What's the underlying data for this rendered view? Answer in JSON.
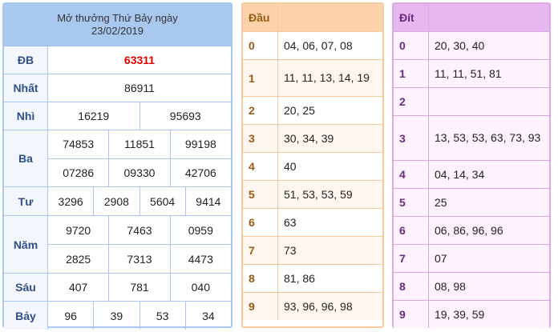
{
  "results": {
    "title_line1": "Mở thưởng Thứ Bảy ngày",
    "title_line2": "23/02/2019",
    "rows": [
      {
        "label": "ĐB",
        "lines": [
          [
            "63311"
          ]
        ]
      },
      {
        "label": "Nhất",
        "lines": [
          [
            "86911"
          ]
        ]
      },
      {
        "label": "Nhì",
        "lines": [
          [
            "16219",
            "95693"
          ]
        ]
      },
      {
        "label": "Ba",
        "lines": [
          [
            "74853",
            "11851",
            "99198"
          ],
          [
            "07286",
            "09330",
            "42706"
          ]
        ]
      },
      {
        "label": "Tư",
        "lines": [
          [
            "3296",
            "2908",
            "5604",
            "9414"
          ]
        ]
      },
      {
        "label": "Năm",
        "lines": [
          [
            "9720",
            "7463",
            "0959"
          ],
          [
            "2825",
            "7313",
            "4473"
          ]
        ]
      },
      {
        "label": "Sáu",
        "lines": [
          [
            "407",
            "781",
            "040"
          ]
        ]
      },
      {
        "label": "Bảy",
        "lines": [
          [
            "96",
            "39",
            "53",
            "34"
          ]
        ]
      }
    ]
  },
  "dau": {
    "header": "Đầu",
    "rows": [
      {
        "key": "0",
        "value": "04, 06, 07, 08"
      },
      {
        "key": "1",
        "value": "11, 11, 13, 14, 19"
      },
      {
        "key": "2",
        "value": "20, 25"
      },
      {
        "key": "3",
        "value": "30, 34, 39"
      },
      {
        "key": "4",
        "value": "40"
      },
      {
        "key": "5",
        "value": "51, 53, 53, 59"
      },
      {
        "key": "6",
        "value": "63"
      },
      {
        "key": "7",
        "value": "73"
      },
      {
        "key": "8",
        "value": "81, 86"
      },
      {
        "key": "9",
        "value": "93, 96, 96, 98"
      }
    ]
  },
  "dit": {
    "header": "Đít",
    "rows": [
      {
        "key": "0",
        "value": "20, 30, 40"
      },
      {
        "key": "1",
        "value": "11, 11, 51, 81"
      },
      {
        "key": "2",
        "value": ""
      },
      {
        "key": "3",
        "value": "13, 53, 53, 63, 73, 93"
      },
      {
        "key": "4",
        "value": "04, 14, 34"
      },
      {
        "key": "5",
        "value": "25"
      },
      {
        "key": "6",
        "value": "06, 86, 96, 96"
      },
      {
        "key": "7",
        "value": "07"
      },
      {
        "key": "8",
        "value": "08, 98"
      },
      {
        "key": "9",
        "value": "19, 39, 59"
      }
    ]
  },
  "colors": {
    "results_accent": "#a9c8ef",
    "dau_accent": "#fbd2a9",
    "dit_accent": "#e7b7ef",
    "special_prize": "#e30000"
  }
}
